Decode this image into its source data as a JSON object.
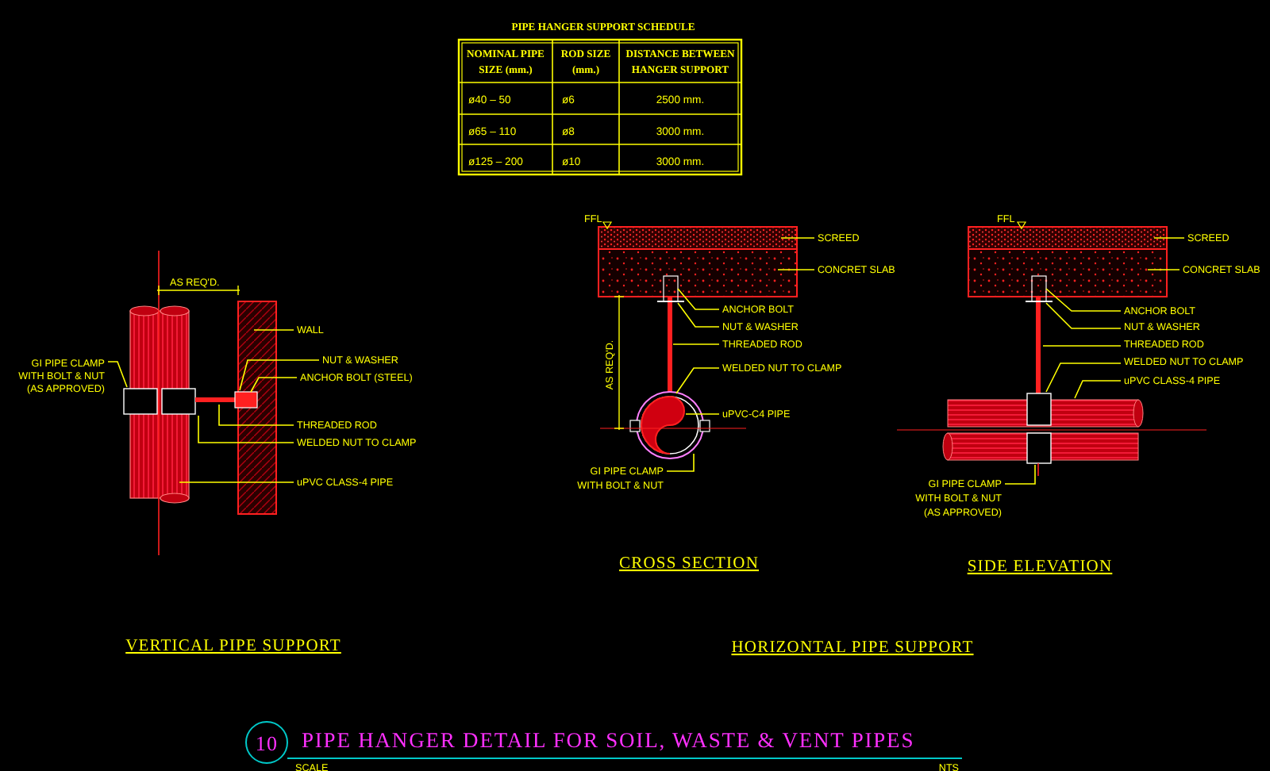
{
  "schedule": {
    "title": "PIPE HANGER SUPPORT SCHEDULE",
    "columns": [
      {
        "lines": [
          "NOMINAL PIPE",
          "SIZE (mm.)"
        ]
      },
      {
        "lines": [
          "ROD SIZE",
          "(mm.)"
        ]
      },
      {
        "lines": [
          "DISTANCE BETWEEN",
          "HANGER SUPPORT"
        ]
      }
    ],
    "rows": [
      [
        "ø40 – 50",
        "ø6",
        "2500 mm."
      ],
      [
        "ø65 – 110",
        "ø8",
        "3000 mm."
      ],
      [
        "ø125 – 200",
        "ø10",
        "3000 mm."
      ]
    ]
  },
  "views": [
    {
      "kind": "vertical",
      "title": "VERTICAL PIPE SUPPORT",
      "labels": [
        {
          "lines": [
            "AS REQ'D."
          ]
        },
        {
          "lines": [
            "WALL"
          ]
        },
        {
          "lines": [
            "GI PIPE CLAMP",
            "WITH BOLT & NUT",
            "(AS APPROVED)"
          ]
        },
        {
          "lines": [
            "NUT & WASHER"
          ]
        },
        {
          "lines": [
            "ANCHOR BOLT (STEEL)"
          ]
        },
        {
          "lines": [
            "THREADED ROD"
          ]
        },
        {
          "lines": [
            "WELDED NUT TO CLAMP"
          ]
        },
        {
          "lines": [
            "uPVC CLASS-4 PIPE"
          ]
        }
      ]
    },
    {
      "kind": "cross",
      "title": "CROSS SECTION",
      "labels": [
        {
          "lines": [
            "FFL"
          ]
        },
        {
          "lines": [
            "SCREED"
          ]
        },
        {
          "lines": [
            "CONCRET SLAB"
          ]
        },
        {
          "lines": [
            "ANCHOR BOLT"
          ]
        },
        {
          "lines": [
            "NUT & WASHER"
          ]
        },
        {
          "lines": [
            "THREADED ROD"
          ]
        },
        {
          "lines": [
            "WELDED NUT TO CLAMP"
          ]
        },
        {
          "lines": [
            "uPVC-C4 PIPE"
          ]
        },
        {
          "lines": [
            "GI PIPE CLAMP",
            "WITH BOLT & NUT"
          ]
        },
        {
          "lines": [
            "AS REQ'D."
          ]
        }
      ]
    },
    {
      "kind": "side",
      "title": "SIDE ELEVATION",
      "labels": [
        {
          "lines": [
            "FFL"
          ]
        },
        {
          "lines": [
            "SCREED"
          ]
        },
        {
          "lines": [
            "CONCRET SLAB"
          ]
        },
        {
          "lines": [
            "ANCHOR BOLT"
          ]
        },
        {
          "lines": [
            "NUT & WASHER"
          ]
        },
        {
          "lines": [
            "THREADED ROD"
          ]
        },
        {
          "lines": [
            "WELDED NUT TO CLAMP"
          ]
        },
        {
          "lines": [
            "uPVC CLASS-4 PIPE"
          ]
        },
        {
          "lines": [
            "GI PIPE CLAMP",
            "WITH BOLT & NUT",
            "(AS APPROVED)"
          ]
        }
      ]
    }
  ],
  "group_title": "HORIZONTAL PIPE SUPPORT",
  "detail": {
    "number": "10",
    "title": "PIPE HANGER DETAIL FOR SOIL, WASTE & VENT PIPES",
    "scale_label": "SCALE",
    "scale": "NTS"
  }
}
